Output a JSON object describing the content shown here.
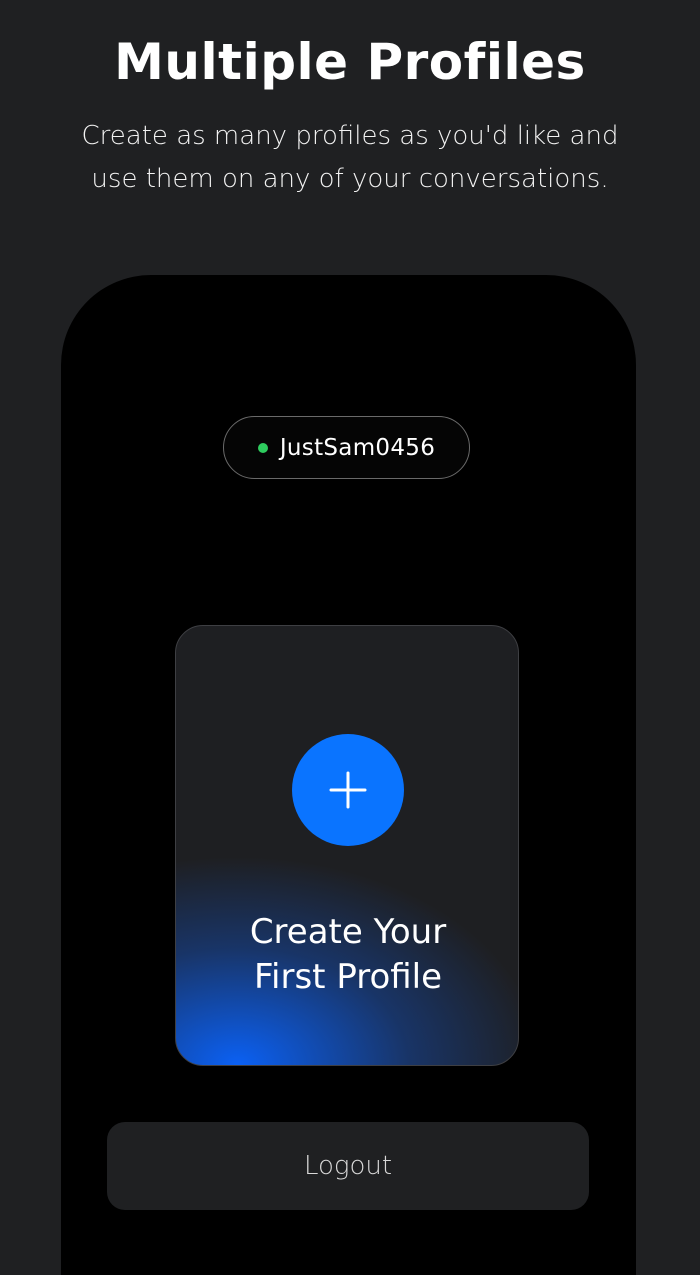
{
  "header": {
    "title": "Multiple Profiles",
    "subtitle": "Create as many profiles as you'd like and use them on any of your conversations."
  },
  "profile_pill": {
    "status": "online",
    "status_color": "#2ecc5e",
    "name": "JustSam0456"
  },
  "create_card": {
    "icon": "plus-icon",
    "label": "Create Your\nFirst Profile",
    "accent_color": "#0a74ff"
  },
  "logout": {
    "label": "Logout"
  }
}
